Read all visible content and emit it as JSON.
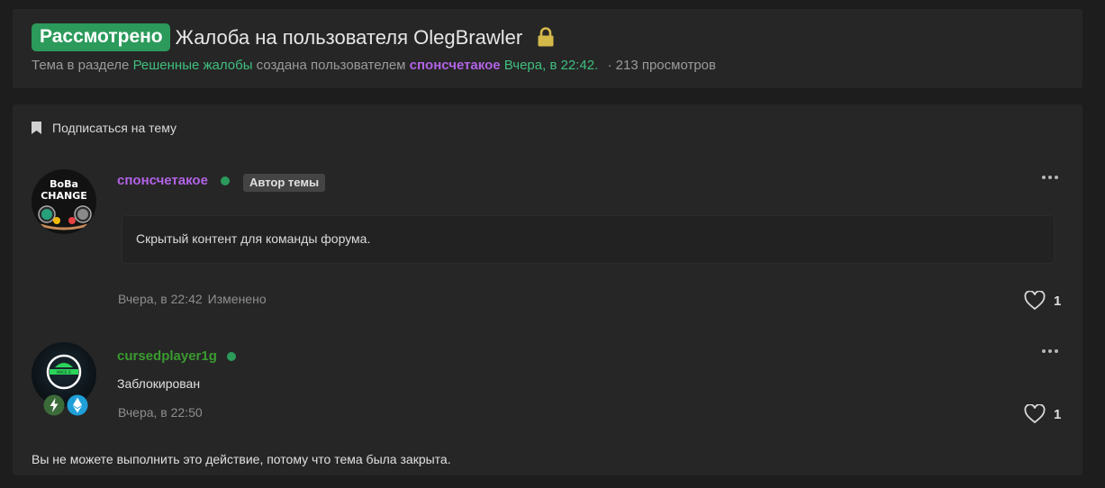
{
  "header": {
    "prefix": "Рассмотрено",
    "title": "Жалоба на пользователя OlegBrawler",
    "lock_icon": "lock-icon",
    "meta": {
      "section_prefix": "Тема в разделе",
      "section_link": "Решенные жалобы",
      "created_by": "создана пользователем",
      "author": "спонсчетакое",
      "date": "Вчера, в 22:42.",
      "views": "· 213 просмотров"
    }
  },
  "subscribe": {
    "label": "Подписаться на тему",
    "icon": "bookmark-icon"
  },
  "posts": [
    {
      "username": "спонсчетакое",
      "username_color": "#b263e6",
      "author_tag": "Автор темы",
      "avatar_text": [
        "BoBa",
        "CHANGE"
      ],
      "body": "Скрытый контент для команды форума.",
      "time": "Вчера, в 22:42",
      "edited": "Изменено",
      "likes": "1"
    },
    {
      "username": "cursedplayer1g",
      "username_color": "#3a9a2f",
      "body": "Заблокирован",
      "time": "Вчера, в 22:50",
      "likes": "1"
    }
  ],
  "closed_note": "Вы не можете выполнить это действие, потому что тема была закрыта.",
  "colors": {
    "prefix_bg": "#2b9a5b",
    "link_green": "#3fbf7f",
    "online": "#2b9a5b",
    "lock": "#d4b84a"
  }
}
